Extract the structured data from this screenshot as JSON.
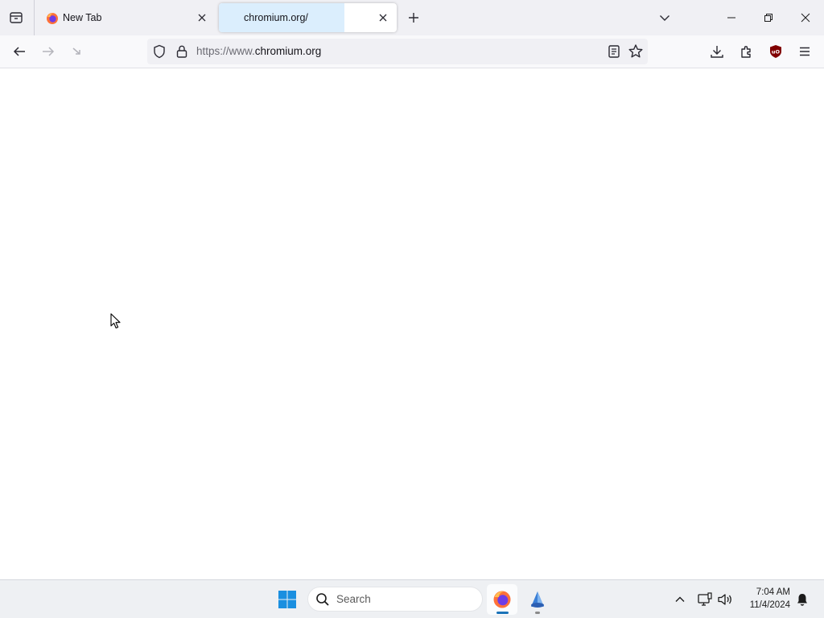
{
  "browser": {
    "tabs": [
      {
        "title": "New Tab",
        "favicon": "firefox-icon",
        "selected": false
      },
      {
        "title": "chromium.org/",
        "favicon": "",
        "selected": true
      }
    ],
    "url": {
      "scheme": "https://www.",
      "host": "chromium.org"
    }
  },
  "taskbar": {
    "search_placeholder": "Search",
    "clock_time": "7:04 AM",
    "clock_date": "11/4/2024"
  },
  "colors": {
    "tabstrip_bg": "#f0f0f4",
    "selected_tab_highlight": "#dbeefd",
    "urlbar_bg": "#f0f0f4",
    "ublock_red": "#800000",
    "firefox_indicator": "#1a73b8"
  },
  "icons": {
    "toolbar": [
      "arrow-left-icon",
      "arrow-right-icon",
      "stop-icon",
      "shield-icon",
      "lock-icon",
      "reader-view-icon",
      "star-icon",
      "download-icon",
      "puzzle-icon",
      "ublock-icon",
      "hamburger-menu-icon"
    ],
    "tray": [
      "chevron-up-icon",
      "network-icon",
      "volume-icon",
      "bell-icon"
    ]
  }
}
